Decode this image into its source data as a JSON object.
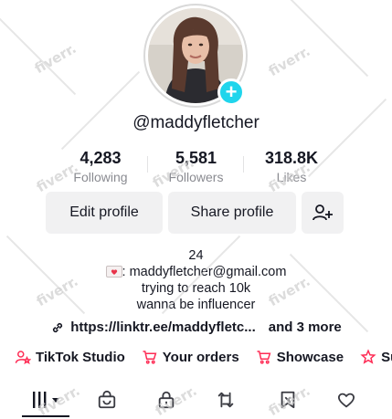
{
  "profile": {
    "username": "@maddyfletcher",
    "add_icon": "plus-icon"
  },
  "stats": [
    {
      "value": "4,283",
      "label": "Following"
    },
    {
      "value": "5,581",
      "label": "Followers"
    },
    {
      "value": "318.8K",
      "label": "Likes"
    }
  ],
  "buttons": {
    "edit": "Edit profile",
    "share": "Share profile",
    "add_friends_icon": "add-person-icon"
  },
  "bio": {
    "line1": "24",
    "line2": ": maddyfletcher@gmail.com",
    "line3": "trying to reach 10k",
    "line4": "wanna be influencer",
    "email_icon": "love-letter-icon"
  },
  "link": {
    "url": "https://linktr.ee/maddyfletc...",
    "more": "and 3 more"
  },
  "tools": [
    {
      "label": "TikTok Studio",
      "icon": "person-star-icon"
    },
    {
      "label": "Your orders",
      "icon": "shopping-cart-icon"
    },
    {
      "label": "Showcase",
      "icon": "shopping-cart-icon"
    },
    {
      "label": "Su",
      "icon": "star-icon"
    }
  ],
  "tabs": [
    {
      "name": "videos",
      "icon": "grid-icon"
    },
    {
      "name": "shop",
      "icon": "bag-icon"
    },
    {
      "name": "private",
      "icon": "lock-icon"
    },
    {
      "name": "reposts",
      "icon": "repost-icon"
    },
    {
      "name": "favorites",
      "icon": "bookmark-icon"
    },
    {
      "name": "liked",
      "icon": "heart-icon"
    }
  ],
  "colors": {
    "accent": "#20d5ec",
    "brand_red": "#fe2c55",
    "muted": "#8a8b91"
  },
  "watermark": "fiverr."
}
